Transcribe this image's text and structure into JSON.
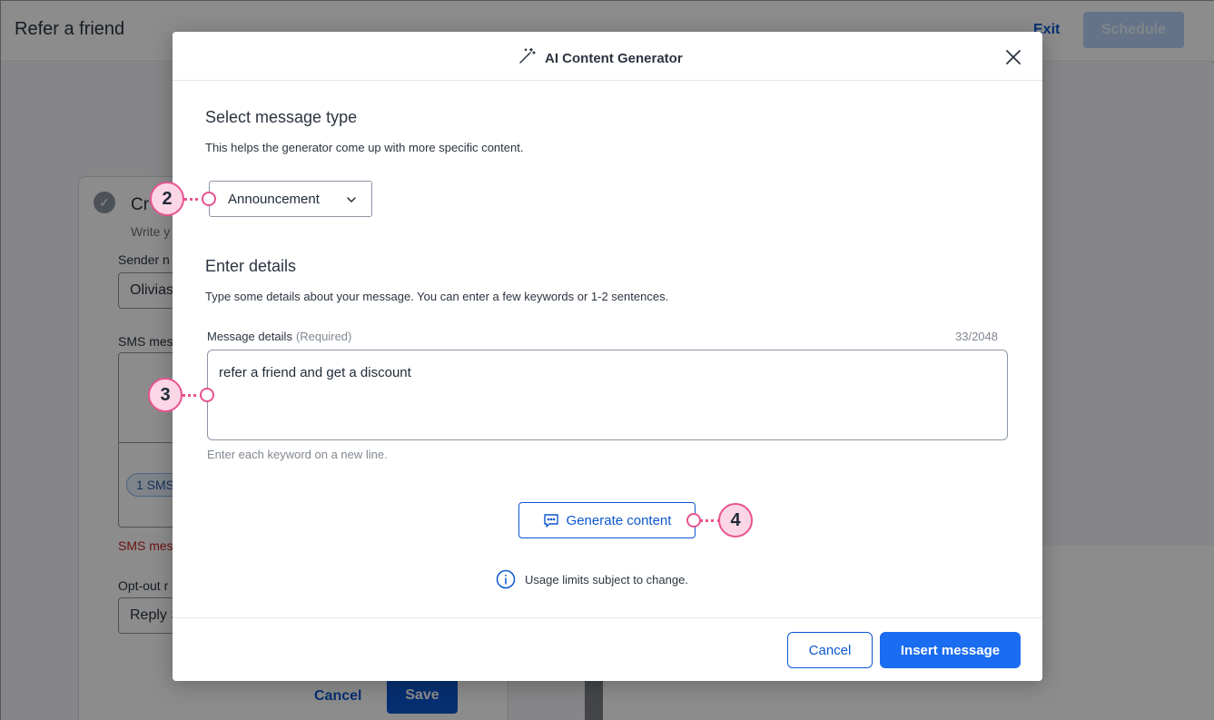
{
  "background": {
    "page_title": "Refer a friend",
    "exit_label": "Exit",
    "schedule_label": "Schedule",
    "step_title": "Cr",
    "step_subtitle": "Write y",
    "sender_label": "Sender n",
    "sender_value": "Olivias",
    "sms_label": "SMS mess",
    "sms_pill": "1 SMS",
    "sms_error": "SMS mess",
    "optout_label": "Opt-out r",
    "optout_value": "Reply S",
    "cancel_label": "Cancel",
    "save_label": "Save"
  },
  "modal": {
    "title": "AI Content Generator",
    "icon": "magic-wand-icon",
    "message_type": {
      "title": "Select message type",
      "description": "This helps the generator come up with more specific content.",
      "selected": "Announcement"
    },
    "details": {
      "title": "Enter details",
      "description": "Type some details about your message. You can enter a few keywords or 1-2 sentences.",
      "field_label": "Message details",
      "field_required": "(Required)",
      "char_count": "33/2048",
      "value": "refer a friend and get a discount",
      "help": "Enter each keyword on a new line."
    },
    "generate_label": "Generate content",
    "usage_note": "Usage limits subject to change.",
    "cancel_label": "Cancel",
    "insert_label": "Insert message"
  },
  "callouts": [
    "2",
    "3",
    "4"
  ],
  "colors": {
    "primary": "#1a6cf0",
    "link": "#0b57d0",
    "callout_border": "#e8538f",
    "callout_fill": "#fbd7e6",
    "error": "#c5221f"
  }
}
